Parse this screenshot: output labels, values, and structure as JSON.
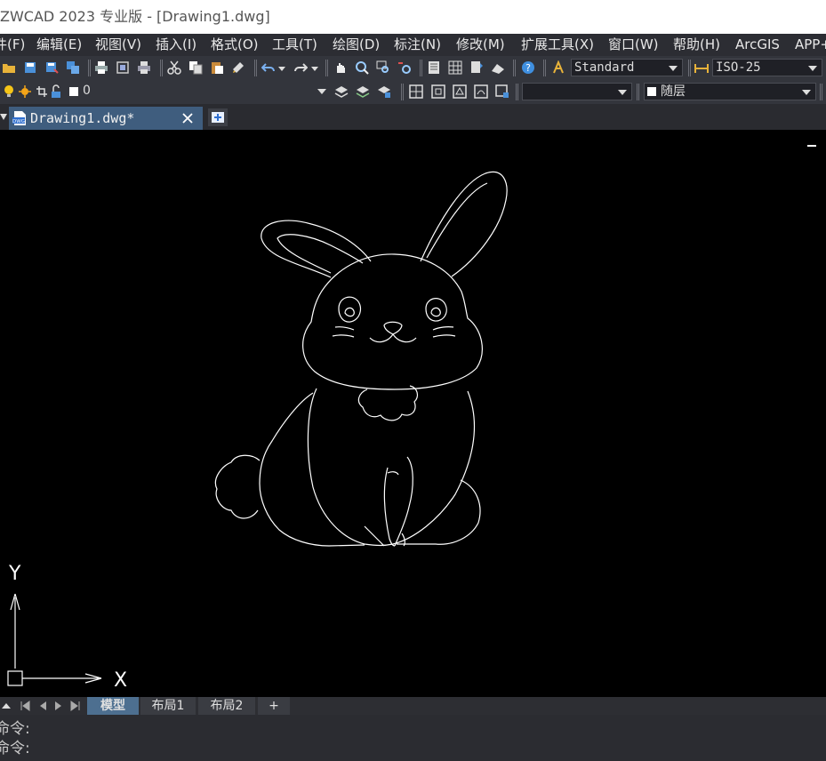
{
  "window": {
    "title": "ZWCAD 2023 专业版 - [Drawing1.dwg]"
  },
  "menu": [
    {
      "label": "件(F)"
    },
    {
      "label": "编辑(E)"
    },
    {
      "label": "视图(V)"
    },
    {
      "label": "插入(I)"
    },
    {
      "label": "格式(O)"
    },
    {
      "label": "工具(T)"
    },
    {
      "label": "绘图(D)"
    },
    {
      "label": "标注(N)"
    },
    {
      "label": "修改(M)"
    },
    {
      "label": "扩展工具(X)"
    },
    {
      "label": "窗口(W)"
    },
    {
      "label": "帮助(H)"
    },
    {
      "label": "ArcGIS"
    },
    {
      "label": "APP+"
    }
  ],
  "toolbar": {
    "text_style": "Standard",
    "dim_style": "ISO-25",
    "layer_name": "0",
    "linetype_value": "",
    "color_value": "随层"
  },
  "document_tab": {
    "label": "Drawing1.dwg*",
    "file_badge": "DWG"
  },
  "ucs": {
    "x_label": "X",
    "y_label": "Y"
  },
  "layout_tabs": [
    {
      "label": "模型",
      "active": true
    },
    {
      "label": "布局1"
    },
    {
      "label": "布局2"
    },
    {
      "label": "+"
    }
  ],
  "command_lines": [
    "命令:",
    "命令:"
  ],
  "colors": {
    "menubar_bg": "#2c2d33",
    "toolbar_bg": "#33353c",
    "canvas_bg": "#000000",
    "doc_tab": "#3f5d7e",
    "active_layout_tab": "#4d6f90"
  }
}
